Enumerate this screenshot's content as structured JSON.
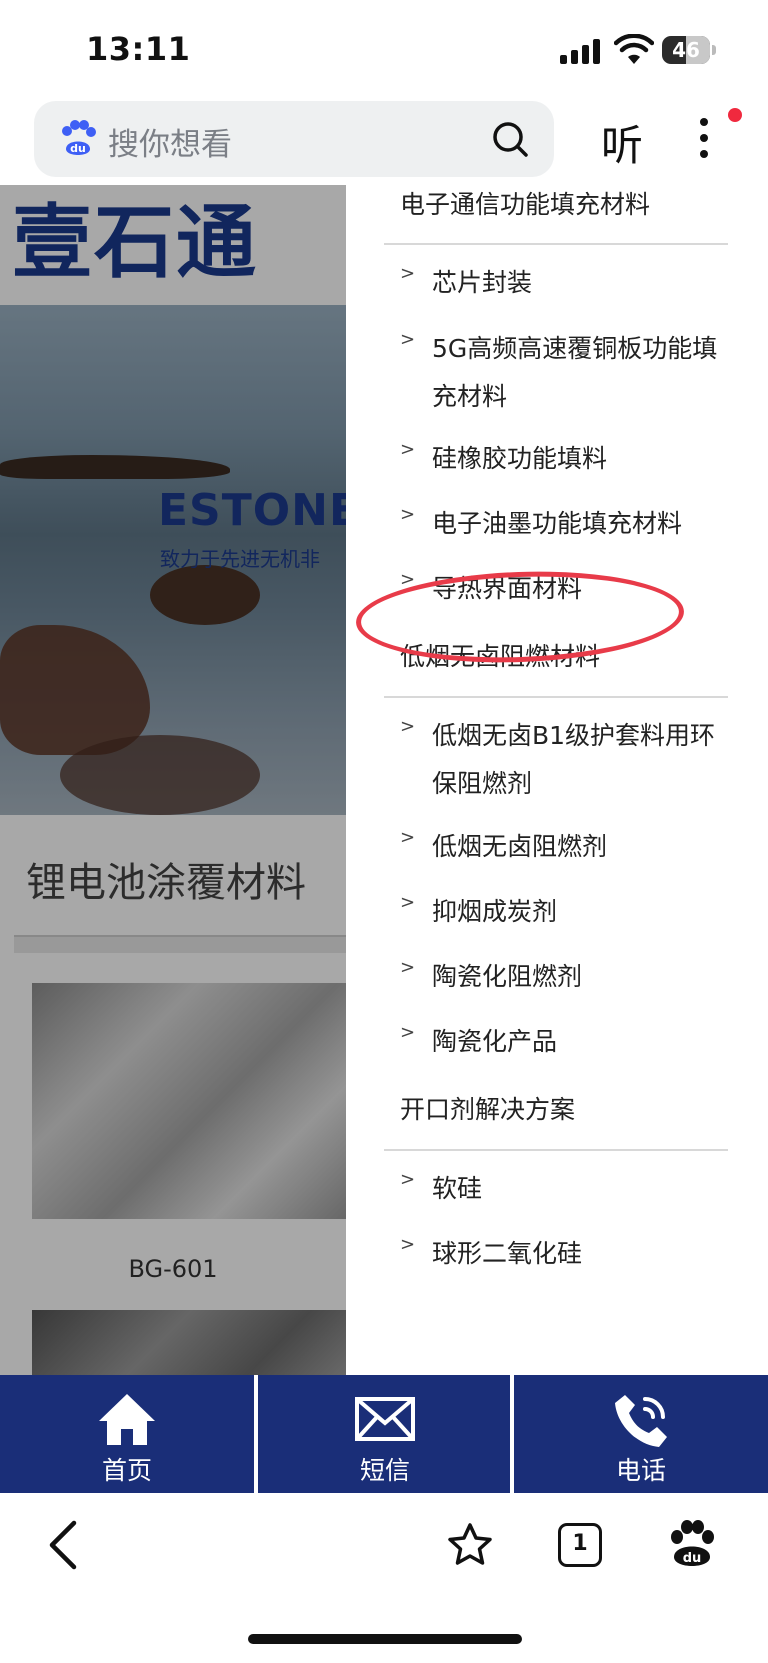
{
  "status_bar": {
    "time": "13:11",
    "battery": "46"
  },
  "browser": {
    "search_placeholder": "搜你想看",
    "listen_label": "听",
    "tab_count": "1"
  },
  "page": {
    "logo_text": "壹石通",
    "hero_title": "ESTONE",
    "hero_subtitle": "致力于先进无机非",
    "section_title": "锂电池涂覆材料",
    "product_label": "BG-601"
  },
  "menu": {
    "categories": [
      {
        "label": "电子通信功能填充材料",
        "items": [
          "芯片封装",
          "5G高频高速覆铜板功能填充材料",
          "硅橡胶功能填料",
          "电子油墨功能填充材料",
          "导热界面材料"
        ]
      },
      {
        "label": "低烟无卤阻燃材料",
        "items": [
          "低烟无卤B1级护套料用环保阻燃剂",
          "低烟无卤阻燃剂",
          "抑烟成炭剂",
          "陶瓷化阻燃剂",
          "陶瓷化产品"
        ]
      },
      {
        "label": "开口剂解决方案",
        "items": [
          "软硅",
          "球形二氧化硅"
        ]
      }
    ],
    "highlighted_item": "导热界面材料",
    "highlight_color": "#e83b49"
  },
  "contact_bar": {
    "home": "首页",
    "sms": "短信",
    "phone": "电话",
    "background": "#1a2e78"
  },
  "icons": [
    "baidu-paw-icon",
    "search-icon",
    "more-icon",
    "chevron-right-icon",
    "home-icon",
    "mail-icon",
    "phone-icon",
    "back-icon",
    "star-icon",
    "tabs-icon",
    "baidu-icon"
  ]
}
